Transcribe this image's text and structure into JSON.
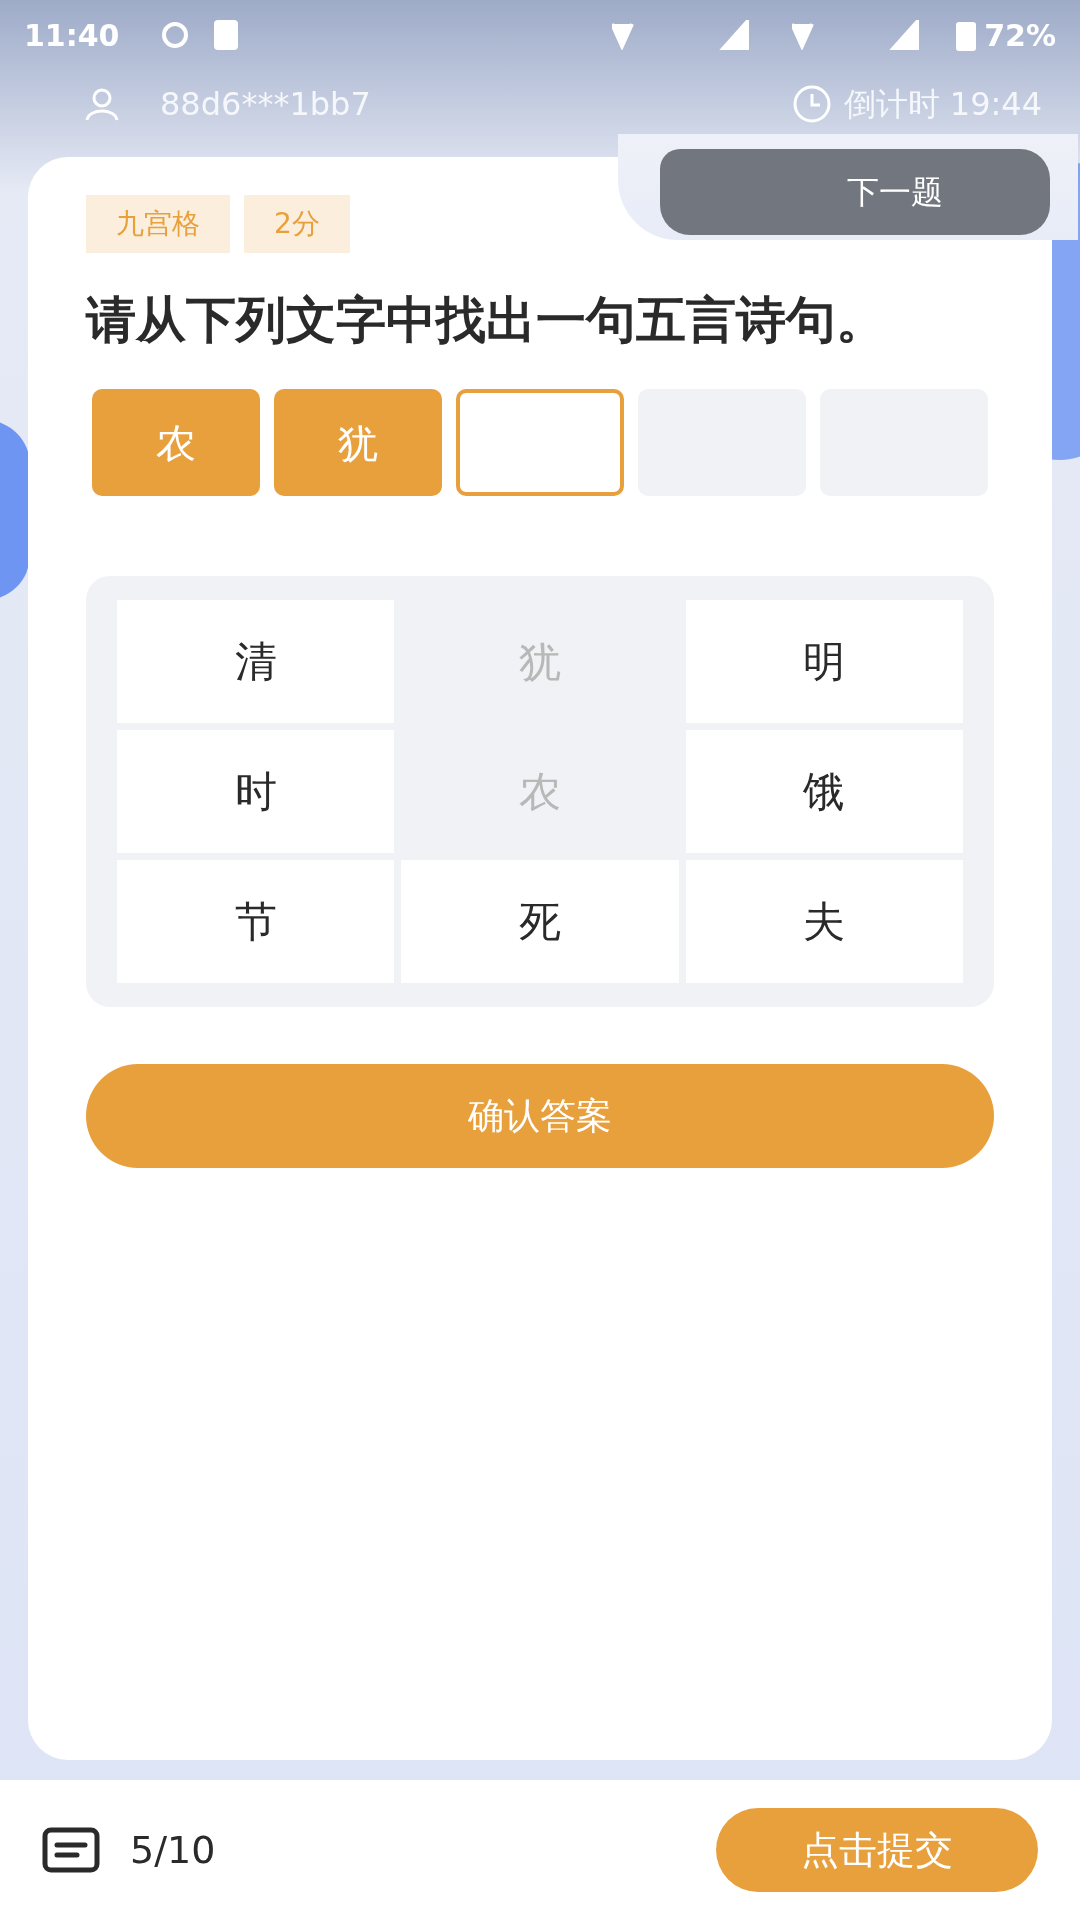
{
  "status_bar": {
    "time": "11:40",
    "battery": "72%"
  },
  "header": {
    "user": "88d6***1bb7",
    "countdown_label": "倒计时 19:44"
  },
  "next_button": "下一题",
  "tags": [
    "九宫格",
    "2分"
  ],
  "question": "请从下列文字中找出一句五言诗句。",
  "answer_slots": [
    {
      "kind": "filled",
      "char": "农"
    },
    {
      "kind": "filled",
      "char": "犹"
    },
    {
      "kind": "current"
    },
    {
      "kind": "empty"
    },
    {
      "kind": "empty"
    }
  ],
  "grid": [
    {
      "char": "清",
      "used": false
    },
    {
      "char": "犹",
      "used": true
    },
    {
      "char": "明",
      "used": false
    },
    {
      "char": "时",
      "used": false
    },
    {
      "char": "农",
      "used": true
    },
    {
      "char": "饿",
      "used": false
    },
    {
      "char": "节",
      "used": false
    },
    {
      "char": "死",
      "used": false
    },
    {
      "char": "夫",
      "used": false
    }
  ],
  "confirm_button": "确认答案",
  "footer": {
    "progress": "5/10",
    "submit_button": "点击提交"
  }
}
